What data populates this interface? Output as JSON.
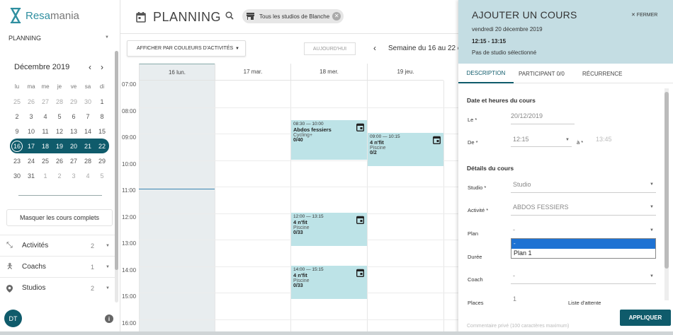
{
  "app": {
    "brand_a": "Resa",
    "brand_b": "mania"
  },
  "nav": {
    "selected": "PLANNING"
  },
  "calendar": {
    "month_label": "Décembre 2019",
    "weekdays": [
      "lu",
      "ma",
      "me",
      "je",
      "ve",
      "sa",
      "di"
    ],
    "weeks": [
      [
        "25",
        "26",
        "27",
        "28",
        "29",
        "30",
        "1"
      ],
      [
        "2",
        "3",
        "4",
        "5",
        "6",
        "7",
        "8"
      ],
      [
        "9",
        "10",
        "11",
        "12",
        "13",
        "14",
        "15"
      ],
      [
        "16",
        "17",
        "18",
        "19",
        "20",
        "21",
        "22"
      ],
      [
        "23",
        "24",
        "25",
        "26",
        "27",
        "28",
        "29"
      ],
      [
        "30",
        "31",
        "1",
        "2",
        "3",
        "4",
        "5"
      ]
    ]
  },
  "sidebar": {
    "hide_full": "Masquer les cours complets",
    "filters": [
      {
        "label": "Activités",
        "count": "2"
      },
      {
        "label": "Coachs",
        "count": "1"
      },
      {
        "label": "Studios",
        "count": "2"
      }
    ],
    "avatar": "DT",
    "info": "i"
  },
  "header": {
    "title": "PLANNING",
    "studio_chip": "Tous les studios de Blanche"
  },
  "toolbar": {
    "colors_btn": "AFFICHER PAR COULEURS D'ACTIVITÉS",
    "today_btn": "AUJOURD'HUI",
    "week_label": "Semaine du 16 au 22 c"
  },
  "planning": {
    "days": [
      "16 lun.",
      "17 mar.",
      "18 mer.",
      "19 jeu."
    ],
    "hours": [
      "07:00",
      "08:00",
      "09:00",
      "10:00",
      "11:00",
      "12:00",
      "13:00",
      "14:00",
      "15:00",
      "16:00"
    ],
    "events": [
      {
        "time": "08:30 — 10:00",
        "name": "Abdos fessiers",
        "location": "Cycling+",
        "places": "0/40"
      },
      {
        "time": "09:00 — 10:15",
        "name": "4 n'fit",
        "location": "Piscine",
        "places": "0/2"
      },
      {
        "time": "12:00 — 13:15",
        "name": "4 n'fit",
        "location": "Piscine",
        "places": "0/33"
      },
      {
        "time": "14:00 — 15:15",
        "name": "4 n'fit",
        "location": "Piscine",
        "places": "0/33"
      }
    ]
  },
  "panel": {
    "title": "AJOUTER UN COURS",
    "close": "✕ FERMER",
    "date": "vendredi 20 décembre 2019",
    "time": "12:15 - 13:15",
    "studio_note": "Pas de studio sélectionné",
    "tabs": [
      "DESCRIPTION",
      "PARTICIPANT 0/0",
      "RÉCURRENCE"
    ],
    "section_dates": "Date et heures du cours",
    "le_label": "Le *",
    "le_value": "20/12/2019",
    "de_label": "De *",
    "de_value": "12:15",
    "a_label": "à *",
    "a_value": "13:45",
    "section_details": "Détails du cours",
    "studio_label": "Studio *",
    "studio_value": "Studio",
    "activite_label": "Activité *",
    "activite_value": "ABDOS FESSIERS",
    "plan_label": "Plan",
    "plan_value": "-",
    "plan_options": [
      "-",
      "Plan 1"
    ],
    "duree_label": "Durée",
    "coach_label": "Coach",
    "coach_value": "-",
    "places_label": "Places",
    "places_value": "1",
    "waitlist_label": "Liste d'attente",
    "comment_label": "Commentaire privé (100 caractères maximum)",
    "apply": "APPLIQUER"
  }
}
